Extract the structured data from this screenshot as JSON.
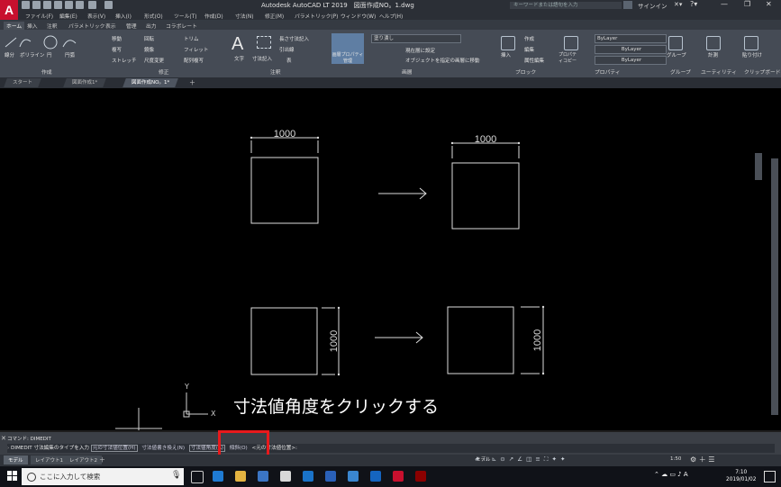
{
  "window": {
    "app_title": "Autodesk AutoCAD LT 2019　図面作成NO。1.dwg",
    "search_placeholder": "キーワードまたは語句を入力",
    "sign_in": "サインイン"
  },
  "menu": [
    "ファイル(F)",
    "編集(E)",
    "表示(V)",
    "挿入(I)",
    "形式(O)",
    "ツール(T)",
    "作成(D)",
    "寸法(N)",
    "修正(M)",
    "パラメトリック(P)",
    "ウィンドウ(W)",
    "ヘルプ(H)"
  ],
  "ribbon_tabs": [
    "ホーム",
    "挿入",
    "注釈",
    "パラメトリック",
    "表示",
    "管理",
    "出力",
    "コラボレート"
  ],
  "ribbon": {
    "draw": {
      "line": "線分",
      "polyline": "ポリライン",
      "circle": "円",
      "arc": "円弧",
      "panel": "作成"
    },
    "modify": {
      "move": "移動",
      "rotate": "回転",
      "trim": "トリム",
      "copy": "複写",
      "mirror": "鏡像",
      "fillet": "フィレット",
      "stretch": "ストレッチ",
      "scale": "尺度変更",
      "array": "配列複写",
      "panel": "修正"
    },
    "annotation": {
      "text": "文字",
      "dimension": "寸法記入",
      "linear": "長さ寸法記入",
      "leader": "引出線",
      "table": "表",
      "panel": "注釈"
    },
    "layers": {
      "properties": "画層プロパティ管理",
      "state": "塗り潰し",
      "set_current": "現在層に設定",
      "move_to_layer": "オブジェクトを指定の画層に移動",
      "panel": "画層"
    },
    "block": {
      "insert": "挿入",
      "create": "作成",
      "edit": "編集",
      "attr_edit": "属性編集",
      "panel": "ブロック"
    },
    "properties": {
      "match": "プロパティコピー",
      "bylayer_1": "ByLayer",
      "bylayer_2": "ByLayer",
      "bylayer_3": "ByLayer",
      "panel": "プロパティ"
    },
    "groups": {
      "group": "グループ",
      "panel": "グループ"
    },
    "utilities": {
      "measure": "計測",
      "panel": "ユーティリティ"
    },
    "clipboard": {
      "paste": "貼り付け",
      "panel": "クリップボード"
    }
  },
  "doc_tabs": [
    "スタート",
    "図面作成1*",
    "図面作成NO。1*"
  ],
  "drawing": {
    "dim_top_left": "1000",
    "dim_top_right": "1000",
    "dim_bottom_left": "1000",
    "dim_bottom_right": "1000",
    "ucs_y": "Y",
    "ucs_x": "X"
  },
  "instruction": "寸法値角度をクリックする",
  "command": {
    "history": "コマンド: DIMEDIT",
    "prompt": "DIMEDIT 寸法編集のタイプを入力",
    "options": [
      "元の寸法値位置(H)",
      "寸法値書き換え(N)",
      "寸法値角度(A)",
      "傾斜(O)"
    ],
    "default": "<元の寸法値位置>:"
  },
  "layout_tabs": [
    "モデル",
    "レイアウト1",
    "レイアウト2"
  ],
  "status": {
    "model": "モデル",
    "scale": "1:50"
  },
  "taskbar": {
    "search": "ここに入力して検索",
    "time": "7:10",
    "date": "2019/01/02"
  }
}
